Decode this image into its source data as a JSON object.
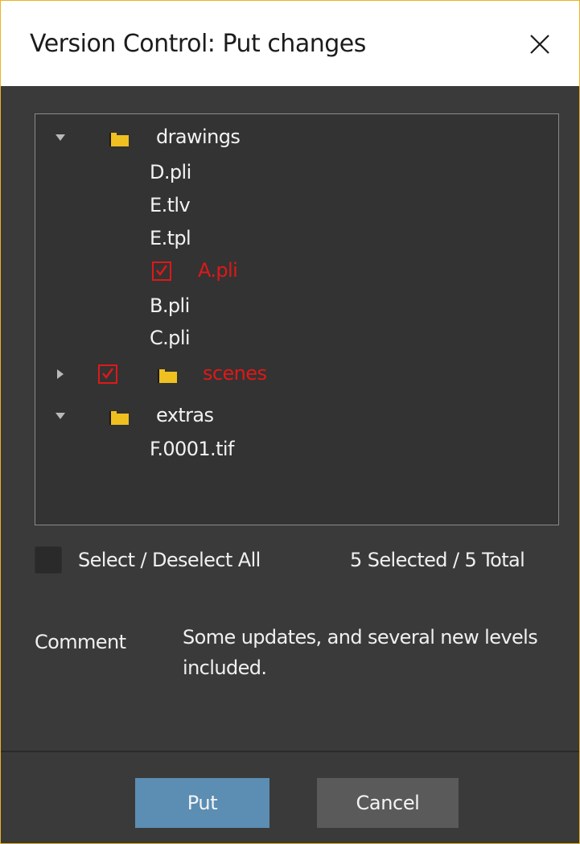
{
  "window": {
    "title": "Version Control: Put changes",
    "close_icon": "close-icon",
    "accent_border_color": "#e8b424"
  },
  "tree": {
    "items": [
      {
        "label": "drawings",
        "type": "folder",
        "expanded": true,
        "checked": false
      },
      {
        "label": "D.pli",
        "type": "file",
        "checked": false
      },
      {
        "label": "E.tlv",
        "type": "file",
        "checked": false
      },
      {
        "label": "E.tpl",
        "type": "file",
        "checked": false
      },
      {
        "label": "A.pli",
        "type": "file",
        "checked": true
      },
      {
        "label": "B.pli",
        "type": "file",
        "checked": false
      },
      {
        "label": "C.pli",
        "type": "file",
        "checked": false
      },
      {
        "label": "scenes",
        "type": "folder",
        "expanded": false,
        "checked": true
      },
      {
        "label": "extras",
        "type": "folder",
        "expanded": true,
        "checked": false
      },
      {
        "label": "F.0001.tif",
        "type": "file",
        "checked": false
      }
    ],
    "checked_color": "#e01818",
    "folder_color": "#f0c020"
  },
  "selection": {
    "select_all_label": "Select / Deselect All",
    "select_all_checked": false,
    "count_text": "5 Selected / 5 Total"
  },
  "comment": {
    "label": "Comment",
    "value": "Some updates, and several new levels included."
  },
  "buttons": {
    "put_label": "Put",
    "cancel_label": "Cancel",
    "put_color": "#5c8db3"
  }
}
